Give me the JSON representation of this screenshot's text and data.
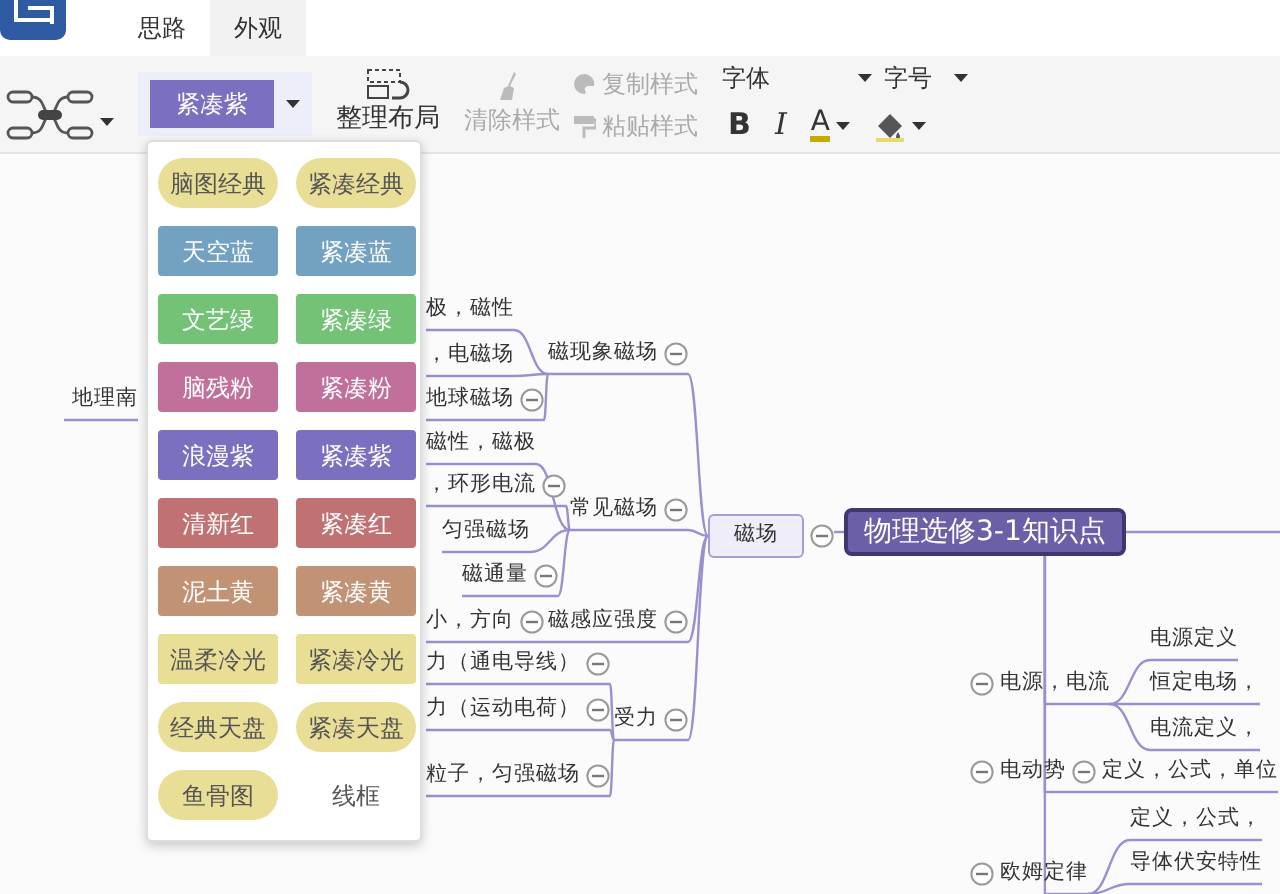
{
  "tabs": [
    {
      "label": "思路",
      "selected": false
    },
    {
      "label": "外观",
      "selected": true
    }
  ],
  "toolbar": {
    "theme": "紧凑紫",
    "tidy_layout": "整理布局",
    "clear_style": {
      "label": "清除样式",
      "disabled": true
    },
    "copy_style": {
      "label": "复制样式",
      "disabled": true
    },
    "paste_style": {
      "label": "粘贴样式",
      "disabled": true
    },
    "font_family": "字体",
    "font_size": "字号",
    "bold": "B",
    "italic": "I",
    "font_color": "A"
  },
  "theme_menu": [
    {
      "label": "脑图经典",
      "kind": "pill",
      "color": "#e9de96"
    },
    {
      "label": "紧凑经典",
      "kind": "pill",
      "color": "#e9de96"
    },
    {
      "label": "天空蓝",
      "kind": "rect",
      "color": "#73a1c2"
    },
    {
      "label": "紧凑蓝",
      "kind": "rect",
      "color": "#73a1c2"
    },
    {
      "label": "文艺绿",
      "kind": "rect",
      "color": "#73c276"
    },
    {
      "label": "紧凑绿",
      "kind": "rect",
      "color": "#73c276"
    },
    {
      "label": "脑残粉",
      "kind": "rect",
      "color": "#c0709a"
    },
    {
      "label": "紧凑粉",
      "kind": "rect",
      "color": "#c0709a"
    },
    {
      "label": "浪漫紫",
      "kind": "rect",
      "color": "#7b70c0"
    },
    {
      "label": "紧凑紫",
      "kind": "rect",
      "color": "#7b70c0"
    },
    {
      "label": "清新红",
      "kind": "rect",
      "color": "#c07272"
    },
    {
      "label": "紧凑红",
      "kind": "rect",
      "color": "#c07272"
    },
    {
      "label": "泥土黄",
      "kind": "rect",
      "color": "#c29274"
    },
    {
      "label": "紧凑黄",
      "kind": "rect",
      "color": "#c29274"
    },
    {
      "label": "温柔冷光",
      "kind": "rect",
      "color": "#e9de96"
    },
    {
      "label": "紧凑冷光",
      "kind": "rect",
      "color": "#e9de96"
    },
    {
      "label": "经典天盘",
      "kind": "pill",
      "color": "#e9de96"
    },
    {
      "label": "紧凑天盘",
      "kind": "pill",
      "color": "#e9de96"
    },
    {
      "label": "鱼骨图",
      "kind": "pill",
      "color": "#e9de96"
    },
    {
      "label": "线框",
      "kind": "plain",
      "color": "#ffffff"
    }
  ],
  "mind_map": {
    "fragments": [
      {
        "label": "地理南"
      }
    ],
    "root": {
      "label": "物理选修3-1知识点",
      "kind": "root",
      "children": [
        {
          "label": "磁场",
          "kind": "main",
          "expanded": true,
          "children": [
            {
              "label": "磁现象磁场",
              "kind": "sub",
              "expanded": true,
              "children": [
                {
                  "label": "极，磁性",
                  "kind": "sub"
                },
                {
                  "label": "，电磁场",
                  "kind": "sub"
                },
                {
                  "label": "地球磁场",
                  "kind": "sub",
                  "expanded": true
                }
              ]
            },
            {
              "label": "常见磁场",
              "kind": "sub",
              "expanded": true,
              "children": [
                {
                  "label": "磁性，磁极",
                  "kind": "sub"
                },
                {
                  "label": "，环形电流",
                  "kind": "sub",
                  "expanded": true
                },
                {
                  "label": "匀强磁场",
                  "kind": "sub"
                },
                {
                  "label": "磁通量",
                  "kind": "sub",
                  "expanded": true
                }
              ]
            },
            {
              "label": "磁感应强度",
              "kind": "sub",
              "expanded": true,
              "children": [
                {
                  "label": "小，方向",
                  "kind": "sub",
                  "expanded": true
                }
              ]
            },
            {
              "label": "受力",
              "kind": "sub",
              "expanded": true,
              "children": [
                {
                  "label": "力（通电导线）",
                  "kind": "sub",
                  "expanded": true
                },
                {
                  "label": "力（运动电荷）",
                  "kind": "sub",
                  "expanded": true
                },
                {
                  "label": "粒子，匀强磁场",
                  "kind": "sub",
                  "expanded": true
                }
              ]
            }
          ]
        },
        {
          "label": "电源，电流",
          "kind": "sub",
          "expanded": true,
          "children": [
            {
              "label": "电源定义",
              "kind": "sub"
            },
            {
              "label": "恒定电场，",
              "kind": "sub"
            },
            {
              "label": "电流定义，",
              "kind": "sub"
            }
          ]
        },
        {
          "label": "电动势",
          "kind": "sub",
          "expanded": true,
          "children": [
            {
              "label": "定义，公式，单位",
              "kind": "sub",
              "expanded": true
            }
          ]
        },
        {
          "label": "欧姆定律",
          "kind": "sub",
          "expanded": true,
          "children": [
            {
              "label": "定义，公式，",
              "kind": "sub"
            },
            {
              "label": "导体伏安特性",
              "kind": "sub"
            }
          ]
        }
      ]
    }
  }
}
